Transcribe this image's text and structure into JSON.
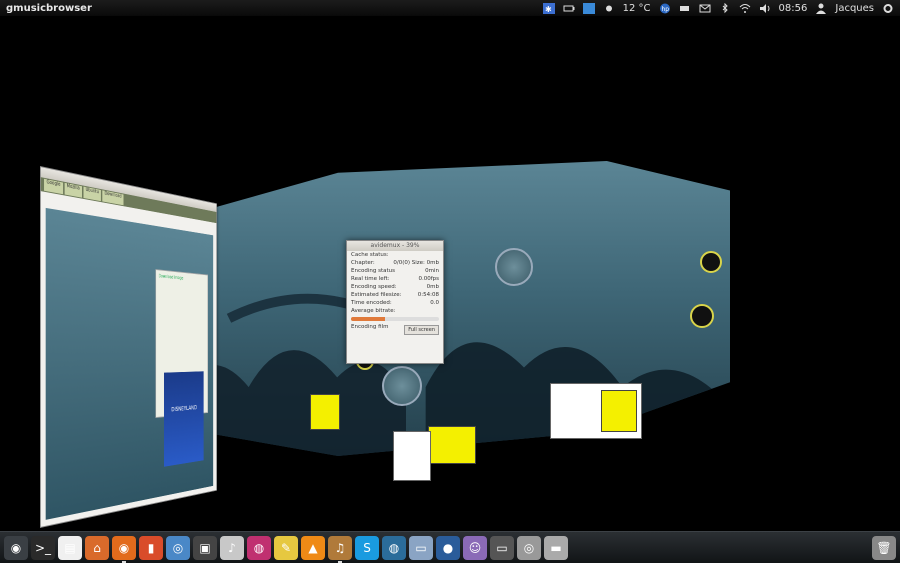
{
  "topbar": {
    "app_name": "gmusicbrowser",
    "temperature": "12 °C",
    "time": "08:56",
    "user": "Jacques"
  },
  "tray_icons": [
    "weather-icon",
    "battery-icon",
    "network-manager-icon",
    "sun-icon",
    "hp-printer-icon",
    "battery-status-icon",
    "mail-icon",
    "bluetooth-icon",
    "wifi-icon",
    "volume-icon",
    "user-icon",
    "gear-icon"
  ],
  "encode_window": {
    "title": "avidemux - 39%",
    "rows": [
      {
        "label": "Cache status:",
        "value": ""
      },
      {
        "label": "Chapter:",
        "value": "0/0(0)   Size:   0mb"
      },
      {
        "label": "Encoding status",
        "value": "0min"
      },
      {
        "label": "Real time left:",
        "value": "0.00fps"
      },
      {
        "label": "Encoding speed:",
        "value": "0mb"
      },
      {
        "label": "Estimated filesize:",
        "value": "0:54:08"
      },
      {
        "label": "Time encoded:",
        "value": "0.0"
      },
      {
        "label": "Average bitrate:",
        "value": ""
      }
    ],
    "progress": 0.39,
    "footer_label": "Encoding film",
    "button_label": "Full screen"
  },
  "browser_window": {
    "tabs": [
      "Google",
      "Mozilla",
      "Ubuntu",
      "Download"
    ],
    "download_title": "Download image",
    "poster_text": "DISNEYLAND"
  },
  "dock_icons": [
    {
      "name": "dash-icon",
      "glyph": "◉",
      "bg": "#3a3f44"
    },
    {
      "name": "terminal-icon",
      "glyph": ">_",
      "bg": "#2a2a2a"
    },
    {
      "name": "text-editor-icon",
      "glyph": "▤",
      "bg": "#f0f0f0"
    },
    {
      "name": "home-folder-icon",
      "glyph": "⌂",
      "bg": "#d96a2b"
    },
    {
      "name": "firefox-icon",
      "glyph": "◉",
      "bg": "#e26b1c",
      "active": true
    },
    {
      "name": "clapper-icon",
      "glyph": "▮",
      "bg": "#d94c2a"
    },
    {
      "name": "chromium-icon",
      "glyph": "◎",
      "bg": "#4a88c7"
    },
    {
      "name": "film-icon",
      "glyph": "▣",
      "bg": "#444"
    },
    {
      "name": "music-player-icon",
      "glyph": "♪",
      "bg": "#c8c8c8"
    },
    {
      "name": "media-icon",
      "glyph": "◍",
      "bg": "#c03070"
    },
    {
      "name": "notes-icon",
      "glyph": "✎",
      "bg": "#e6c840"
    },
    {
      "name": "vlc-icon",
      "glyph": "▲",
      "bg": "#ef8a16"
    },
    {
      "name": "gmusicbrowser-icon",
      "glyph": "♫",
      "bg": "#b07a3a",
      "active": true
    },
    {
      "name": "skype-icon",
      "glyph": "S",
      "bg": "#1a9be0"
    },
    {
      "name": "wireless-icon",
      "glyph": "◍",
      "bg": "#2b6c9a"
    },
    {
      "name": "screenshot-icon",
      "glyph": "▭",
      "bg": "#8aa4c4"
    },
    {
      "name": "drop-icon",
      "glyph": "●",
      "bg": "#2a5c9a"
    },
    {
      "name": "pidgin-icon",
      "glyph": "☺",
      "bg": "#8a6ab7"
    },
    {
      "name": "window-icon",
      "glyph": "▭",
      "bg": "#555"
    },
    {
      "name": "cd-icon",
      "glyph": "◎",
      "bg": "#999"
    },
    {
      "name": "drive-icon",
      "glyph": "▬",
      "bg": "#aaa"
    }
  ],
  "trash_icon": {
    "name": "trash-icon",
    "glyph": "🗑",
    "bg": "#888"
  },
  "colors": {
    "wallpaper": "#3e6676",
    "sticky": "#f4f000",
    "progress": "#e07a3b"
  }
}
